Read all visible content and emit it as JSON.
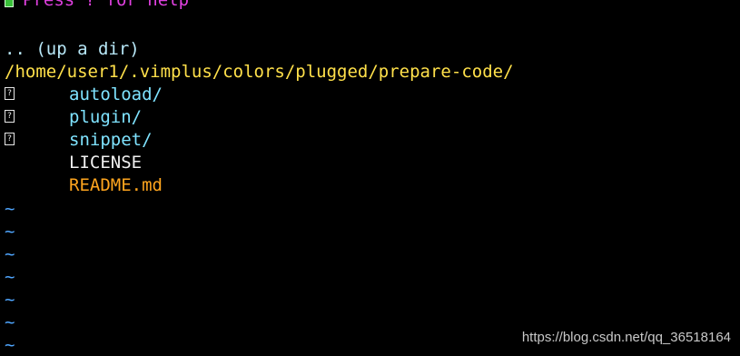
{
  "help_text": "Press ? for help",
  "up_dir": ".. (up a dir)",
  "current_path": "/home/user1/.vimplus/colors/plugged/prepare-code/",
  "entries": [
    {
      "marker": "?",
      "name": "autoload/",
      "kind": "dir"
    },
    {
      "marker": "?",
      "name": "plugin/",
      "kind": "dir"
    },
    {
      "marker": "?",
      "name": "snippet/",
      "kind": "dir"
    },
    {
      "marker": "",
      "name": "LICENSE",
      "kind": "file"
    },
    {
      "marker": "",
      "name": "README.md",
      "kind": "readme"
    }
  ],
  "tildes": [
    "~",
    "~",
    "~",
    "~",
    "~",
    "~",
    "~"
  ],
  "watermark": "https://blog.csdn.net/qq_36518164",
  "colors": {
    "background": "#000000",
    "help_text": "#e040e0",
    "cursor": "#39c039",
    "up_dir": "#b8e8f8",
    "path": "#ffe04a",
    "directory": "#7fe3ff",
    "file": "#f0f0f0",
    "readme": "#ffa51e",
    "tilde": "#4fa6ff"
  }
}
